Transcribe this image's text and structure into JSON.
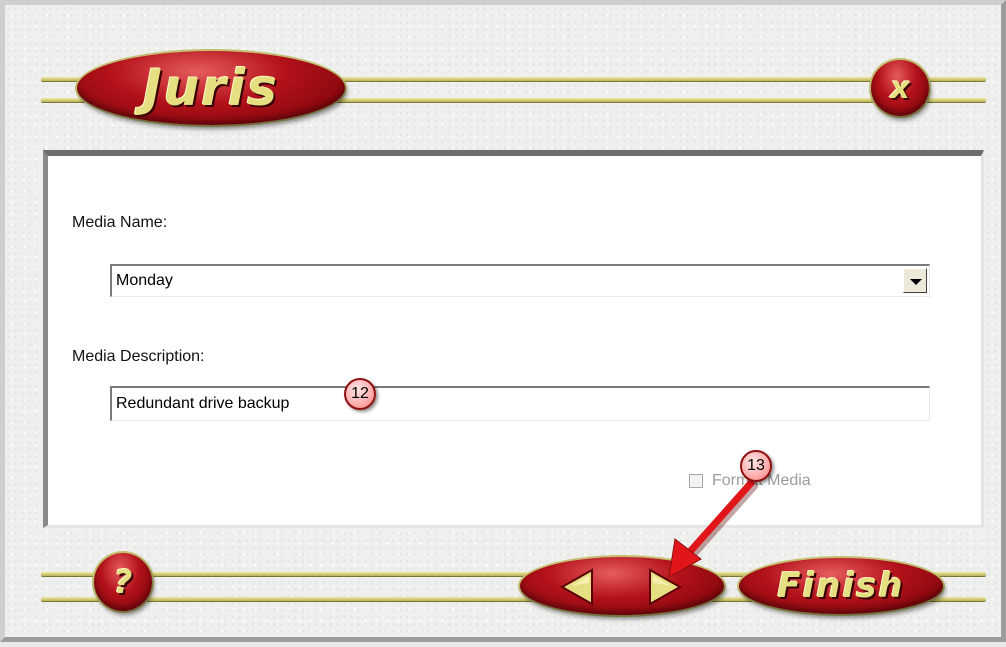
{
  "header": {
    "logo_text": "Juris",
    "close_label": "x"
  },
  "form": {
    "media_name_label": "Media Name:",
    "media_name_value": "Monday",
    "media_description_label": "Media Description:",
    "media_description_value": "Redundant drive backup",
    "format_media_label": "Format Media"
  },
  "annotations": {
    "step_12": "12",
    "step_13": "13"
  },
  "footer": {
    "help_label": "?",
    "finish_label": "Finish"
  },
  "icons": {
    "back": "arrow-left-icon",
    "next": "arrow-right-icon",
    "dropdown": "chevron-down-icon"
  },
  "colors": {
    "button_red": "#b3121a",
    "button_text": "#e6df82",
    "rail": "#d6cf7a",
    "annotation_arrow": "#e0161b"
  }
}
